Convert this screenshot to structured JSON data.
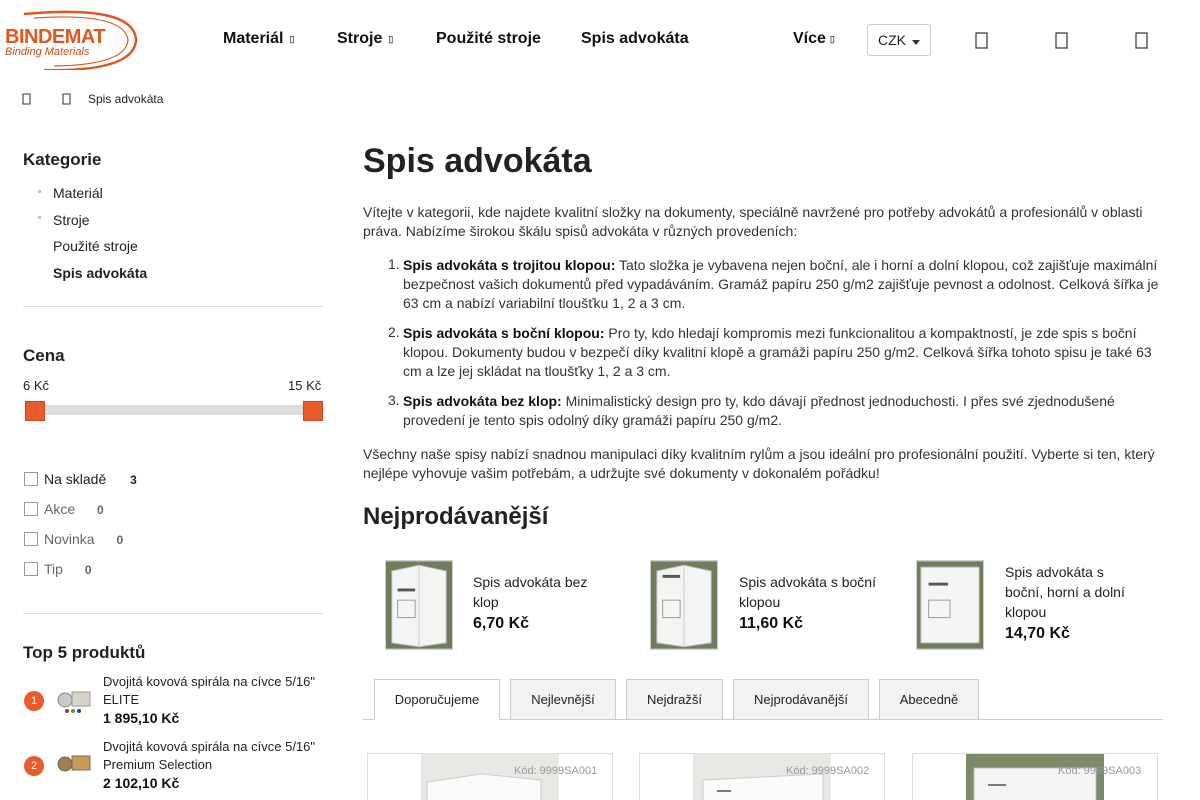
{
  "header": {
    "logo_main": "BINDEMAT",
    "logo_sub": "Binding Materials",
    "nav": [
      {
        "label": "Materiál",
        "has_dropdown": true
      },
      {
        "label": "Stroje",
        "has_dropdown": true
      },
      {
        "label": "Použité stroje",
        "has_dropdown": false
      },
      {
        "label": "Spis advokáta",
        "has_dropdown": false
      },
      {
        "label": "Více",
        "has_dropdown": true
      }
    ],
    "currency": "CZK",
    "icons": [
      "search-icon",
      "user-icon",
      "cart-icon"
    ]
  },
  "breadcrumb": {
    "home_icon": "home-icon",
    "separator_icon": "chevron-right-icon",
    "current": "Spis advokáta"
  },
  "sidebar": {
    "categories_title": "Kategorie",
    "categories": [
      {
        "label": "Materiál",
        "expandable": true
      },
      {
        "label": "Stroje",
        "expandable": true
      },
      {
        "label": "Použité stroje",
        "expandable": false
      },
      {
        "label": "Spis advokáta",
        "active": true
      }
    ],
    "price_title": "Cena",
    "price_min": "6 Kč",
    "price_max": "15 Kč",
    "filters": [
      {
        "label": "Na skladě",
        "count": "3"
      },
      {
        "label": "Akce",
        "count": "0"
      },
      {
        "label": "Novinka",
        "count": "0"
      },
      {
        "label": "Tip",
        "count": "0"
      }
    ],
    "top_title": "Top 5 produktů",
    "top_products": [
      {
        "rank": "1",
        "name": "Dvojitá kovová spirála na cívce 5/16\" ELITE",
        "price": "1 895,10 Kč"
      },
      {
        "rank": "2",
        "name": "Dvojitá kovová spirála na cívce 5/16\" Premium Selection",
        "price": "2 102,10 Kč"
      }
    ]
  },
  "main": {
    "title": "Spis advokáta",
    "intro": "Vítejte v kategorii, kde najdete kvalitní složky na dokumenty, speciálně navržené pro potřeby advokátů a profesionálů v oblasti práva. Nabízíme širokou škálu spisů advokáta v různých provedeních:",
    "list": [
      {
        "num": "1.",
        "bold": "Spis advokáta s trojitou klopou:",
        "text": " Tato složka je vybavena nejen boční, ale i horní a dolní klopou, což zajišťuje maximální bezpečnost vašich dokumentů před vypadáváním. Gramáž papíru 250 g/m2 zajišťuje pevnost a odolnost. Celková šířka je 63 cm a nabízí variabilní tloušťku 1, 2 a 3 cm."
      },
      {
        "num": "2.",
        "bold": "Spis advokáta s boční klopou:",
        "text": " Pro ty, kdo hledají kompromis mezi funkcionalitou a kompaktností, je zde spis s boční klopou. Dokumenty budou v bezpečí díky kvalitní klopě a gramáži papíru 250 g/m2. Celková šířka tohoto spisu je také 63 cm a lze jej skládat na tloušťky 1, 2 a 3 cm."
      },
      {
        "num": "3.",
        "bold": "Spis advokáta bez klop:",
        "text": " Minimalistický design pro ty, kdo dávají přednost jednoduchosti. I přes své zjednodušené provedení je tento spis odolný díky gramáži papíru 250 g/m2."
      }
    ],
    "outro": "Všechny naše spisy nabízí snadnou manipulaci díky kvalitním rylům a jsou ideální pro profesionální použití. Vyberte si ten, který nejlépe vyhovuje vašim potřebám, a udržujte své dokumenty v dokonalém pořádku!",
    "bestsellers_title": "Nejprodávanější",
    "bestsellers": [
      {
        "name": "Spis advokáta bez klop",
        "price": "6,70 Kč"
      },
      {
        "name": "Spis advokáta s boční klopou",
        "price": "11,60 Kč"
      },
      {
        "name": "Spis advokáta s boční, horní a dolní klopou",
        "price": "14,70 Kč"
      }
    ],
    "tabs": [
      {
        "label": "Doporučujeme",
        "active": true
      },
      {
        "label": "Nejlevnější"
      },
      {
        "label": "Nejdražší"
      },
      {
        "label": "Nejprodávanější"
      },
      {
        "label": "Abecedně"
      }
    ],
    "products": [
      {
        "code": "Kód: 9999SA001"
      },
      {
        "code": "Kód: 9999SA002"
      },
      {
        "code": "Kód: 9999SA003"
      }
    ],
    "folder_label": "SPIS ADVOKÁTA"
  }
}
